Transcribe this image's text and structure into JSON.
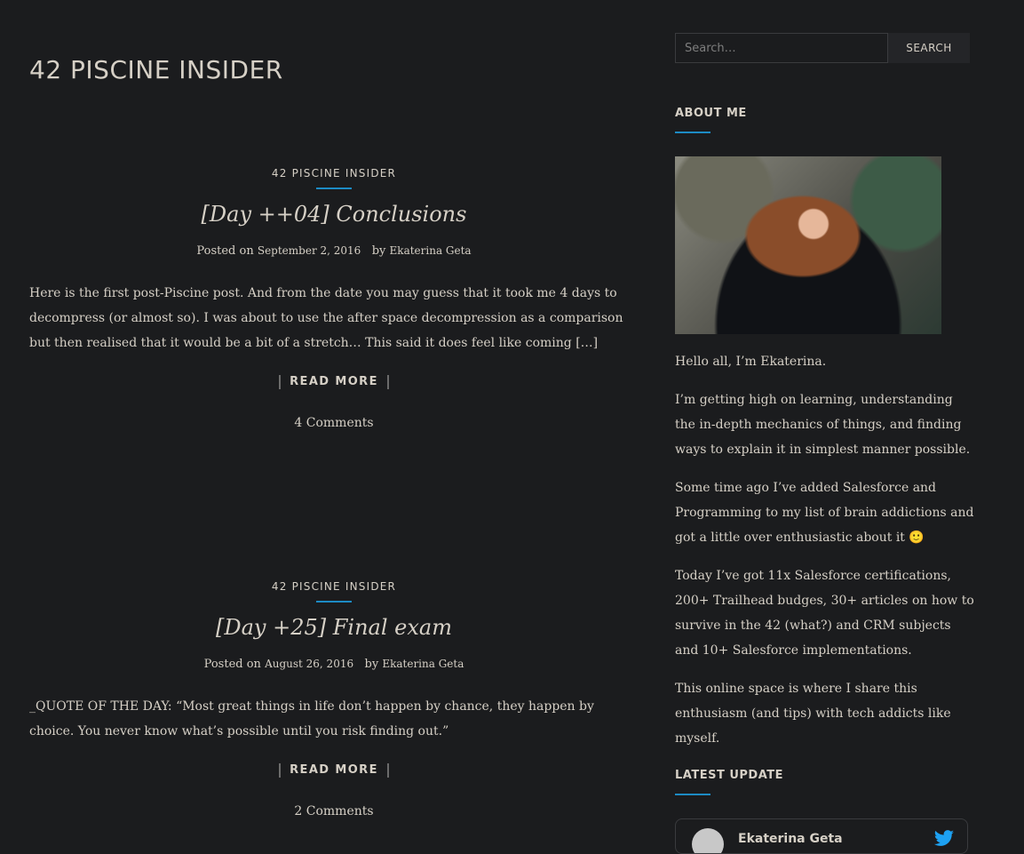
{
  "site": {
    "title": "42 PISCINE INSIDER"
  },
  "posts": [
    {
      "category": "42 PISCINE INSIDER",
      "title": "[Day ++04] Conclusions",
      "posted_on": "Posted on",
      "date": "September 2, 2016",
      "by": "by",
      "author": "Ekaterina Geta",
      "excerpt": "Here is the first post-Piscine post. And from the date you may guess that it took me 4 days to decompress (or almost so). I was about to use the after space decompression as a comparison but then realised that it would be a bit of a stretch… This said it does feel like coming […]",
      "read_more": "READ MORE",
      "comments": "4 Comments"
    },
    {
      "category": "42 PISCINE INSIDER",
      "title": "[Day +25] Final exam",
      "posted_on": "Posted on",
      "date": "August 26, 2016",
      "by": "by",
      "author": "Ekaterina Geta",
      "excerpt": "_QUOTE OF THE DAY: “Most great things in life don’t happen by chance, they happen by choice. You never know what’s possible until you risk finding out.”",
      "read_more": "READ MORE",
      "comments": "2 Comments"
    }
  ],
  "sidebar": {
    "search": {
      "placeholder": "Search…",
      "button": "SEARCH"
    },
    "about": {
      "title": "ABOUT ME",
      "paragraphs": [
        "Hello all, I’m Ekaterina.",
        "I’m getting high on learning, understanding the in-depth mechanics of things, and finding ways to explain it in simplest manner possible.",
        "Some time ago I’ve added Salesforce and Programming to my list of brain addictions and got a little over enthusiastic about it 🙂",
        "Today I’ve got 11x Salesforce certifications, 200+ Trailhead budges, 30+ articles on how to survive in the 42 (what?) and CRM subjects and  10+ Salesforce implementations.",
        "This online space is where I share this enthusiasm (and tips) with tech addicts like myself."
      ]
    },
    "latest": {
      "title": "LATEST UPDATE",
      "tweet_name": "Ekaterina Geta"
    }
  },
  "colors": {
    "background": "#1b1c1e",
    "accent": "#1d8bc4",
    "text": "#d6d0c6"
  }
}
